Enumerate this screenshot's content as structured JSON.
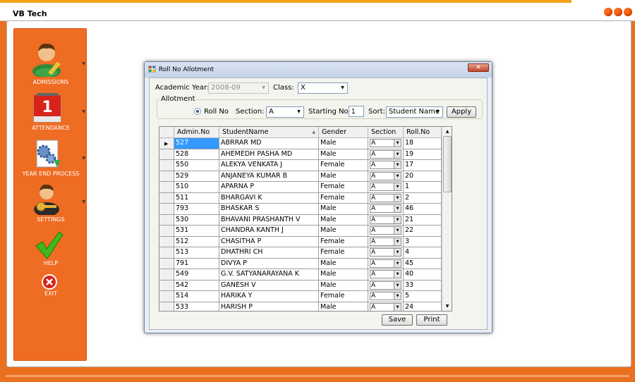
{
  "app": {
    "title": "VB Tech"
  },
  "colors": {
    "accent": "#ef6c23",
    "selection": "#3399ff"
  },
  "sidebar": {
    "items": [
      {
        "label": "ADMISSIONS",
        "icon": "student-avatar-icon",
        "has_menu": true
      },
      {
        "label": "ATTENDANCE",
        "icon": "calendar-icon",
        "has_menu": true
      },
      {
        "label": "YEAR END PROCESS",
        "icon": "document-gear-icon",
        "has_menu": true
      },
      {
        "label": "SETTINGS",
        "icon": "person-key-icon",
        "has_menu": true
      },
      {
        "label": "HELP",
        "icon": "checkmark-icon",
        "has_menu": false
      },
      {
        "label": "EXIT",
        "icon": "close-circle-icon",
        "has_menu": false
      }
    ]
  },
  "dialog": {
    "title": "Roll No Allotment",
    "academic_year_label": "Academic Year:",
    "academic_year_value": "2008-09",
    "class_label": "Class:",
    "class_value": "X",
    "allotment_group": "Allotment",
    "radio_label": "Roll No",
    "section_label": "Section:",
    "section_value": "A",
    "starting_no_label": "Starting No:",
    "starting_no_value": "1",
    "sort_label": "Sort:",
    "sort_value": "Student Name",
    "apply_label": "Apply",
    "save_label": "Save",
    "print_label": "Print"
  },
  "grid": {
    "columns": [
      "Admin.No",
      "StudentName",
      "Gender",
      "Section",
      "Roll.No"
    ],
    "sorted_column": "StudentName",
    "selected_row": 0,
    "rows": [
      {
        "admin": "527",
        "name": "ABRRAR MD",
        "gender": "Male",
        "section": "A",
        "roll": "18"
      },
      {
        "admin": "528",
        "name": "AHEMEDH PASHA MD",
        "gender": "Male",
        "section": "A",
        "roll": "19"
      },
      {
        "admin": "550",
        "name": "ALEKYA VENKATA J",
        "gender": "Female",
        "section": "A",
        "roll": "17"
      },
      {
        "admin": "529",
        "name": "ANJANEYA KUMAR B",
        "gender": "Male",
        "section": "A",
        "roll": "20"
      },
      {
        "admin": "510",
        "name": "APARNA P",
        "gender": "Female",
        "section": "A",
        "roll": "1"
      },
      {
        "admin": "511",
        "name": "BHARGAVI K",
        "gender": "Female",
        "section": "A",
        "roll": "2"
      },
      {
        "admin": "793",
        "name": "BHASKAR S",
        "gender": "Male",
        "section": "A",
        "roll": "46"
      },
      {
        "admin": "530",
        "name": "BHAVANI PRASHANTH V",
        "gender": "Male",
        "section": "A",
        "roll": "21"
      },
      {
        "admin": "531",
        "name": "CHANDRA KANTH J",
        "gender": "Male",
        "section": "A",
        "roll": "22"
      },
      {
        "admin": "512",
        "name": "CHASITHA P",
        "gender": "Female",
        "section": "A",
        "roll": "3"
      },
      {
        "admin": "513",
        "name": "DHATHRI CH",
        "gender": "Female",
        "section": "A",
        "roll": "4"
      },
      {
        "admin": "791",
        "name": "DIVYA  P",
        "gender": "Male",
        "section": "A",
        "roll": "45"
      },
      {
        "admin": "549",
        "name": "G.V. SATYANARAYANA K",
        "gender": "Male",
        "section": "A",
        "roll": "40"
      },
      {
        "admin": "542",
        "name": "GANESH V",
        "gender": "Male",
        "section": "A",
        "roll": "33"
      },
      {
        "admin": "514",
        "name": "HARIKA Y",
        "gender": "Female",
        "section": "A",
        "roll": "5"
      },
      {
        "admin": "533",
        "name": "HARISH P",
        "gender": "Male",
        "section": "A",
        "roll": "24"
      }
    ]
  }
}
